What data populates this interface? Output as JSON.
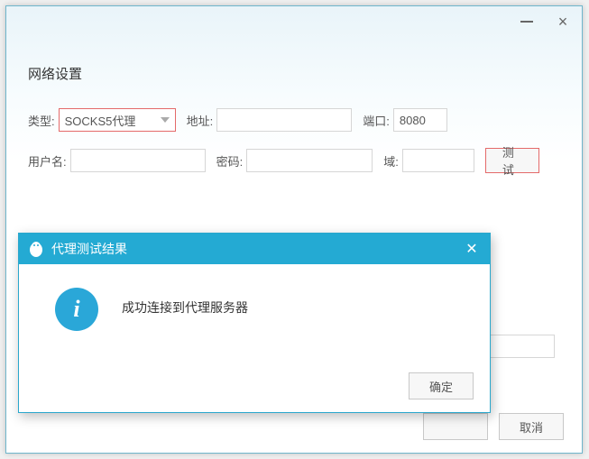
{
  "window": {
    "minimize": "minimize",
    "close": "close"
  },
  "section_title": "网络设置",
  "labels": {
    "type": "类型:",
    "address": "地址:",
    "port": "端口:",
    "username": "用户名:",
    "password": "密码:",
    "domain": "域:"
  },
  "values": {
    "type_selected": "SOCKS5代理",
    "address": "",
    "port": "8080",
    "username": "",
    "password": "",
    "domain": ""
  },
  "buttons": {
    "test": "测试",
    "cancel": "取消",
    "ok_hidden": "确定"
  },
  "modal": {
    "title": "代理测试结果",
    "message": "成功连接到代理服务器",
    "ok": "确定"
  }
}
